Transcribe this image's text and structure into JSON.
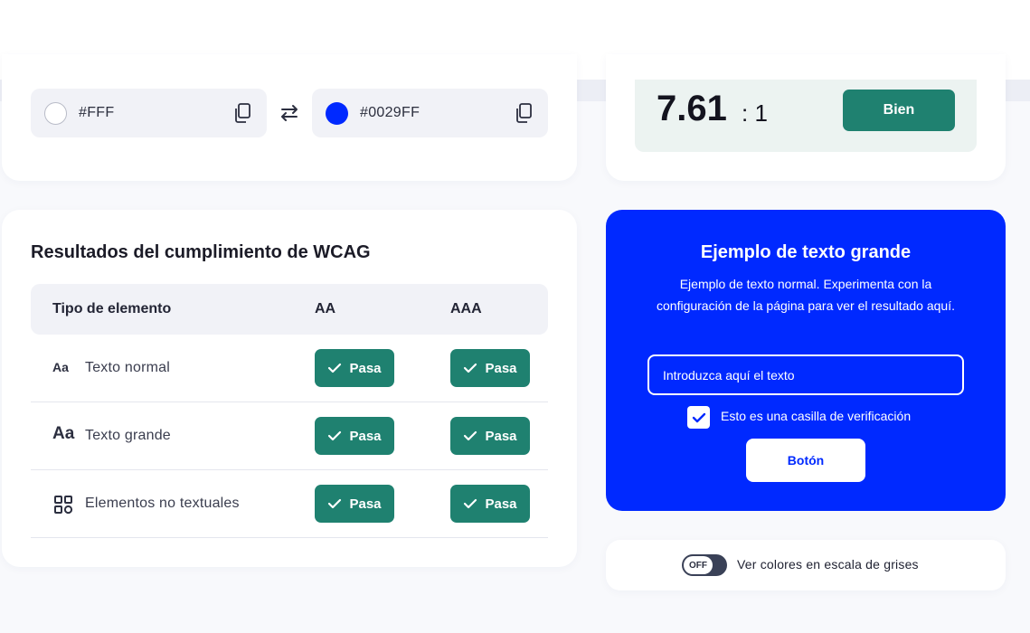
{
  "colors": {
    "foreground": {
      "code": "#FFF",
      "swatch": "#ffffff"
    },
    "background": {
      "code": "#0029FF",
      "swatch": "#0029ff"
    },
    "accent_green": "#1f8170",
    "preview_blue": "#0029ff"
  },
  "icons": {
    "copy": "copy-icon",
    "swap": "swap-arrows-icon",
    "check": "check-icon",
    "grid": "grid-icon"
  },
  "contrast": {
    "value": "7.61",
    "suffix": ": 1",
    "rating": "Bien"
  },
  "results": {
    "title": "Resultados del cumplimiento de WCAG",
    "headers": {
      "type": "Tipo de elemento",
      "aa": "AA",
      "aaa": "AAA"
    },
    "rows": [
      {
        "icon_text": "Aa",
        "label": "Texto normal",
        "aa": "Pasa",
        "aaa": "Pasa"
      },
      {
        "icon_text": "Aa",
        "label": "Texto grande",
        "aa": "Pasa",
        "aaa": "Pasa"
      },
      {
        "icon_text": "",
        "label": "Elementos no textuales",
        "aa": "Pasa",
        "aaa": "Pasa"
      }
    ]
  },
  "preview": {
    "title": "Ejemplo de texto grande",
    "text": "Ejemplo de texto normal. Experimenta con la configuración de la página para ver el resultado aquí.",
    "input_placeholder": "Introduzca aquí el texto",
    "checkbox_label": "Esto es una casilla de verificación",
    "checkbox_checked": true,
    "button_label": "Botón"
  },
  "grayscale": {
    "state": "OFF",
    "label": "Ver colores en escala de grises"
  }
}
